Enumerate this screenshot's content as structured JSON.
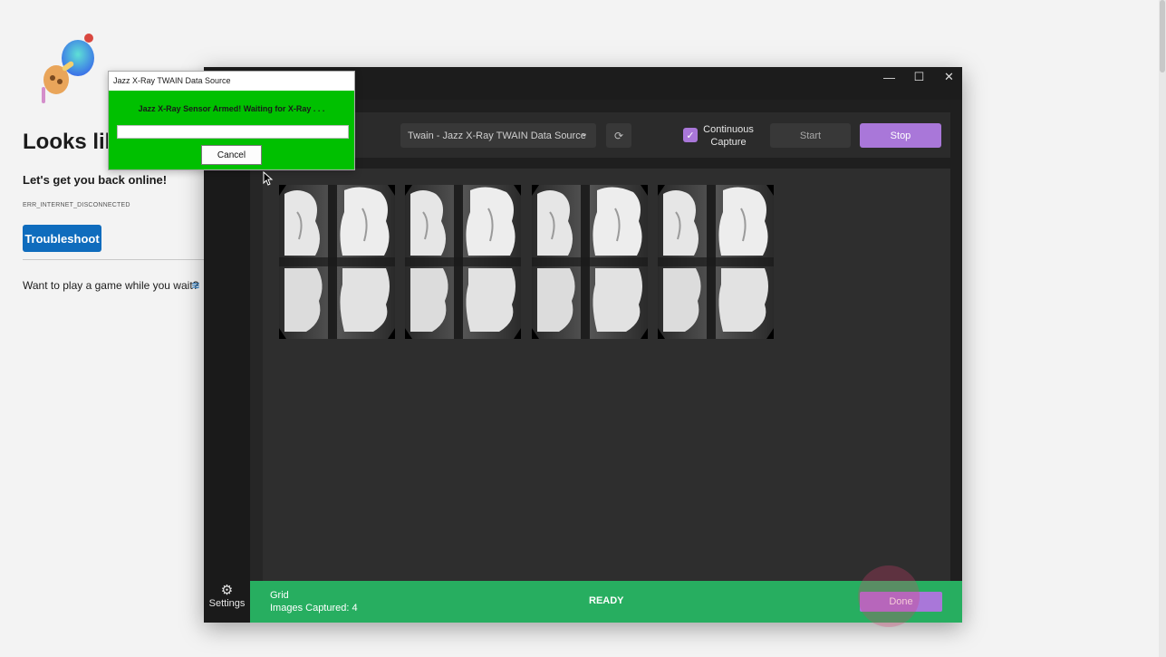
{
  "browser_page": {
    "title": "Looks lik",
    "subtitle": "Let's get you back online!",
    "error_code": "ERR_INTERNET_DISCONNECTED",
    "troubleshoot_label": "Troubleshoot",
    "game_prompt": "Want to play a game while you wait?",
    "game_icon": "≋"
  },
  "window_controls": {
    "minimize": "—",
    "maximize": "☐",
    "close": "✕"
  },
  "toolbar": {
    "source_value": "Twain - Jazz X-Ray TWAIN Data Source",
    "chevron": "⌄",
    "refresh_icon": "⟳",
    "continuous_capture_label": "Continuous Capture",
    "continuous_capture_checked": true,
    "checkmark": "✓",
    "start_label": "Start",
    "stop_label": "Stop"
  },
  "images": {
    "count": 4
  },
  "sidebar": {
    "gear": "⚙",
    "settings_label": "Settings"
  },
  "statusbar": {
    "view_mode": "Grid",
    "images_captured": "Images Captured: 4",
    "status": "READY",
    "done_label": "Done"
  },
  "dialog": {
    "title": "Jazz X-Ray TWAIN Data Source",
    "message": "Jazz X-Ray Sensor Armed! Waiting for X-Ray . . .",
    "cancel_label": "Cancel",
    "progress": 0
  },
  "colors": {
    "accent_purple": "#a977d9",
    "status_green": "#27ae60",
    "dialog_green": "#00c000",
    "link_blue": "#0f6cbd"
  }
}
